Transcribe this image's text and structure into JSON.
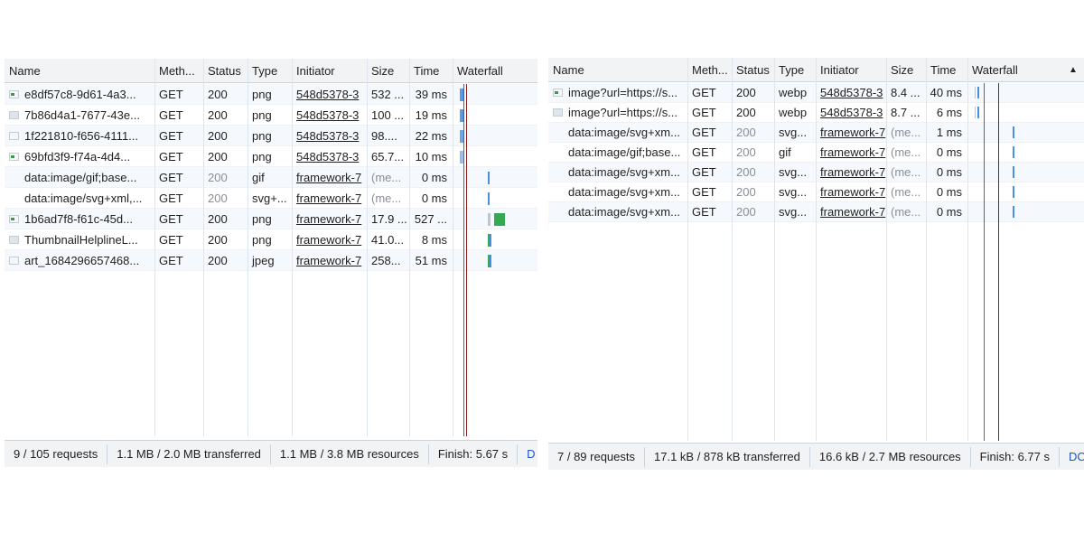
{
  "left_panel": {
    "columns": [
      "Name",
      "Meth...",
      "Status",
      "Type",
      "Initiator",
      "Size",
      "Time",
      "Waterfall"
    ],
    "rows": [
      {
        "icon": "image-icon",
        "name": "e8df57c8-9d61-4a3...",
        "method": "GET",
        "status": "200",
        "type": "png",
        "initiator": "548d5378-3",
        "size": "532 ...",
        "time": "39 ms",
        "status_muted": false,
        "size_muted": false
      },
      {
        "icon": "image-icon",
        "name": "7b86d4a1-7677-43e...",
        "method": "GET",
        "status": "200",
        "type": "png",
        "initiator": "548d5378-3",
        "size": "100 ...",
        "time": "19 ms",
        "status_muted": false,
        "size_muted": false
      },
      {
        "icon": "image-icon",
        "name": "1f221810-f656-4111...",
        "method": "GET",
        "status": "200",
        "type": "png",
        "initiator": "548d5378-3",
        "size": "98....",
        "time": "22 ms",
        "status_muted": false,
        "size_muted": false
      },
      {
        "icon": "image-icon",
        "name": "69bfd3f9-f74a-4d4...",
        "method": "GET",
        "status": "200",
        "type": "png",
        "initiator": "548d5378-3",
        "size": "65.7...",
        "time": "10 ms",
        "status_muted": false,
        "size_muted": false
      },
      {
        "icon": "none",
        "name": "data:image/gif;base...",
        "method": "GET",
        "status": "200",
        "type": "gif",
        "initiator": "framework-7",
        "size": "(me...",
        "time": "0 ms",
        "status_muted": true,
        "size_muted": true
      },
      {
        "icon": "none",
        "name": "data:image/svg+xml,...",
        "method": "GET",
        "status": "200",
        "type": "svg+...",
        "initiator": "framework-7",
        "size": "(me...",
        "time": "0 ms",
        "status_muted": true,
        "size_muted": true
      },
      {
        "icon": "image-icon",
        "name": "1b6ad7f8-f61c-45d...",
        "method": "GET",
        "status": "200",
        "type": "png",
        "initiator": "framework-7",
        "size": "17.9 ...",
        "time": "527 ...",
        "status_muted": false,
        "size_muted": false
      },
      {
        "icon": "image-icon",
        "name": "ThumbnailHelplineL...",
        "method": "GET",
        "status": "200",
        "type": "png",
        "initiator": "framework-7",
        "size": "41.0...",
        "time": "8 ms",
        "status_muted": false,
        "size_muted": false
      },
      {
        "icon": "image-icon",
        "name": "art_1684296657468...",
        "method": "GET",
        "status": "200",
        "type": "jpeg",
        "initiator": "framework-7",
        "size": "258...",
        "time": "51 ms",
        "status_muted": false,
        "size_muted": false
      }
    ],
    "footer": [
      "9 / 105 requests",
      "1.1 MB / 2.0 MB transferred",
      "1.1 MB / 3.8 MB resources",
      "Finish: 5.67 s",
      "D"
    ]
  },
  "right_panel": {
    "columns": [
      "Name",
      "Meth...",
      "Status",
      "Type",
      "Initiator",
      "Size",
      "Time",
      "Waterfall"
    ],
    "rows": [
      {
        "icon": "image-icon",
        "name": "image?url=https://s...",
        "method": "GET",
        "status": "200",
        "type": "webp",
        "initiator": "548d5378-3",
        "size": "8.4 ...",
        "time": "40 ms",
        "status_muted": false,
        "size_muted": false
      },
      {
        "icon": "image-icon",
        "name": "image?url=https://s...",
        "method": "GET",
        "status": "200",
        "type": "webp",
        "initiator": "548d5378-3",
        "size": "8.7 ...",
        "time": "6 ms",
        "status_muted": false,
        "size_muted": false
      },
      {
        "icon": "none",
        "name": "data:image/svg+xm...",
        "method": "GET",
        "status": "200",
        "type": "svg...",
        "initiator": "framework-7",
        "size": "(me...",
        "time": "1 ms",
        "status_muted": true,
        "size_muted": true
      },
      {
        "icon": "none",
        "name": "data:image/gif;base...",
        "method": "GET",
        "status": "200",
        "type": "gif",
        "initiator": "framework-7",
        "size": "(me...",
        "time": "0 ms",
        "status_muted": true,
        "size_muted": true
      },
      {
        "icon": "none",
        "name": "data:image/svg+xm...",
        "method": "GET",
        "status": "200",
        "type": "svg...",
        "initiator": "framework-7",
        "size": "(me...",
        "time": "0 ms",
        "status_muted": true,
        "size_muted": true
      },
      {
        "icon": "none",
        "name": "data:image/svg+xm...",
        "method": "GET",
        "status": "200",
        "type": "svg...",
        "initiator": "framework-7",
        "size": "(me...",
        "time": "0 ms",
        "status_muted": true,
        "size_muted": true
      },
      {
        "icon": "none",
        "name": "data:image/svg+xm...",
        "method": "GET",
        "status": "200",
        "type": "svg...",
        "initiator": "framework-7",
        "size": "(me...",
        "time": "0 ms",
        "status_muted": true,
        "size_muted": true
      }
    ],
    "sort_icon": "sort-ascending-icon",
    "footer": [
      "7 / 89 requests",
      "17.1 kB / 878 kB transferred",
      "16.6 kB / 2.7 MB resources",
      "Finish: 6.77 s",
      "DOM"
    ]
  },
  "colors": {
    "waterfall_blue": "#4a90e2",
    "waterfall_green": "#34a853",
    "dom_content_loaded_line": "#3367d6",
    "load_line": "#8b1a1a",
    "header_bg": "#f1f3f4",
    "alt_row_bg": "#f5f8fd"
  }
}
